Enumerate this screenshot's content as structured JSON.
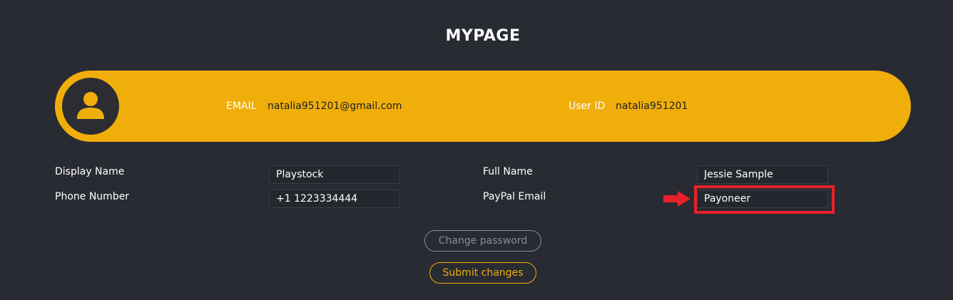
{
  "page": {
    "title": "MYPAGE"
  },
  "profile": {
    "email_label": "EMAIL",
    "email_value": "natalia951201@gmail.com",
    "user_id_label": "User ID",
    "user_id_value": "natalia951201",
    "avatar_icon": "user-icon"
  },
  "form": {
    "display_name": {
      "label": "Display Name",
      "value": "Playstock"
    },
    "phone_number": {
      "label": "Phone Number",
      "value": "+1 1223334444"
    },
    "full_name": {
      "label": "Full Name",
      "value": "Jessie Sample"
    },
    "paypal_email": {
      "label": "PayPal Email",
      "value": "Payoneer"
    }
  },
  "buttons": {
    "change_password": "Change password",
    "submit_changes": "Submit changes"
  },
  "annotation": {
    "arrow_icon": "right-arrow-icon",
    "highlight_color": "#e8212a"
  },
  "colors": {
    "background": "#282b32",
    "accent": "#f0ae0a"
  }
}
